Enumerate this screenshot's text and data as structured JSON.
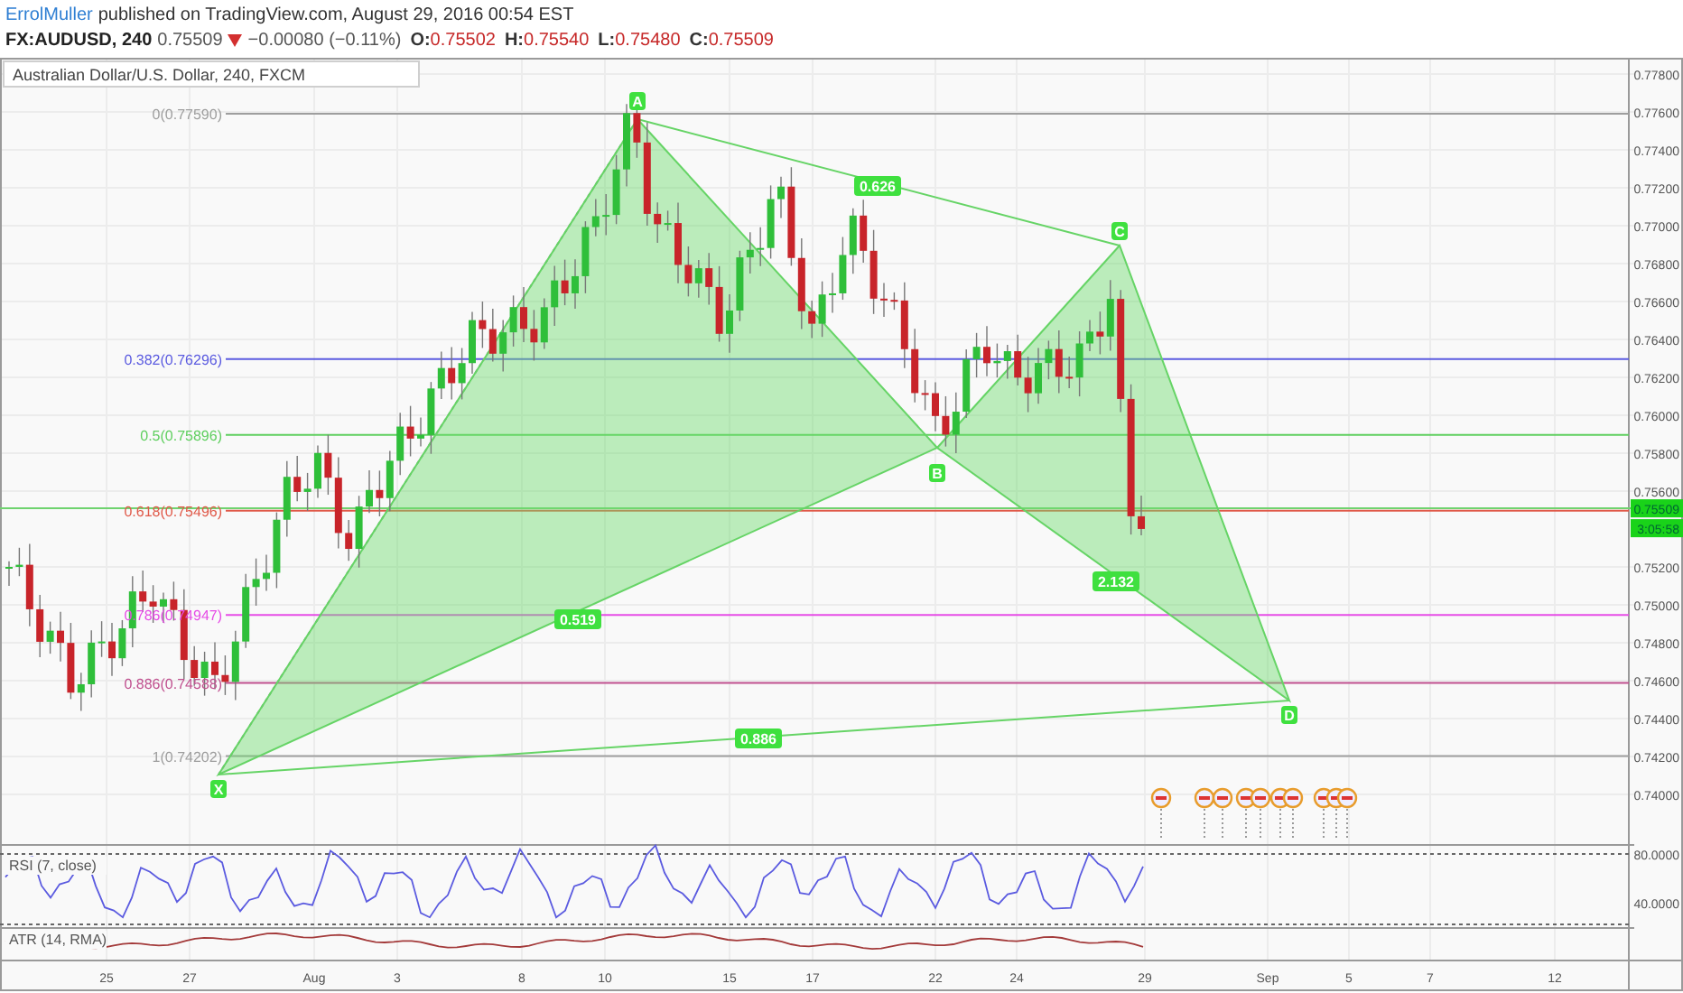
{
  "header": {
    "author": "ErrolMuller",
    "published": "published on TradingView.com, August 29, 2016 00:54 EST"
  },
  "quote": {
    "symbol": "FX:AUDUSD, 240",
    "last": "0.75509",
    "down": true,
    "change": "−0.00080 (−0.11%)",
    "ohlc": [
      {
        "label": "O:",
        "value": "0.75502"
      },
      {
        "label": "H:",
        "value": "0.75540"
      },
      {
        "label": "L:",
        "value": "0.75480"
      },
      {
        "label": "C:",
        "value": "0.75509"
      }
    ]
  },
  "chart": {
    "title": "Australian Dollar/U.S. Dollar, 240, FXCM",
    "fib_levels": [
      {
        "label": "0(0.77590)",
        "color": "#9e9e9e"
      },
      {
        "label": "0.382(0.76296)",
        "color": "#5b5be0"
      },
      {
        "label": "0.5(0.75896)",
        "color": "#5fcf5f"
      },
      {
        "label": "0.618(0.75496)",
        "color": "#e05a4a"
      },
      {
        "label": "0.786(0.74947)",
        "color": "#e64ce6"
      },
      {
        "label": "0.886(0.74588)",
        "color": "#c0508f"
      },
      {
        "label": "1(0.74202)",
        "color": "#9e9e9e"
      }
    ],
    "pattern_points": [
      "X",
      "A",
      "B",
      "C",
      "D"
    ],
    "pattern_ratios": [
      "0.626",
      "0.519",
      "2.132",
      "0.886"
    ],
    "price_ticks": [
      "0.77800",
      "0.77600",
      "0.77400",
      "0.77200",
      "0.77000",
      "0.76800",
      "0.76600",
      "0.76400",
      "0.76200",
      "0.76000",
      "0.75800",
      "0.75600",
      "0.75200",
      "0.75000",
      "0.74800",
      "0.74600",
      "0.74400",
      "0.74200",
      "0.74000"
    ],
    "price_badge": "0.75509",
    "countdown_badge": "3:05:58"
  },
  "rsi": {
    "label": "RSI (7, close)",
    "ticks": [
      "80.0000",
      "40.0000"
    ]
  },
  "atr": {
    "label": "ATR (14, RMA)"
  },
  "time_axis": [
    "25",
    "27",
    "Aug",
    "3",
    "8",
    "10",
    "15",
    "17",
    "22",
    "24",
    "29",
    "Sep",
    "5",
    "7",
    "12"
  ]
}
